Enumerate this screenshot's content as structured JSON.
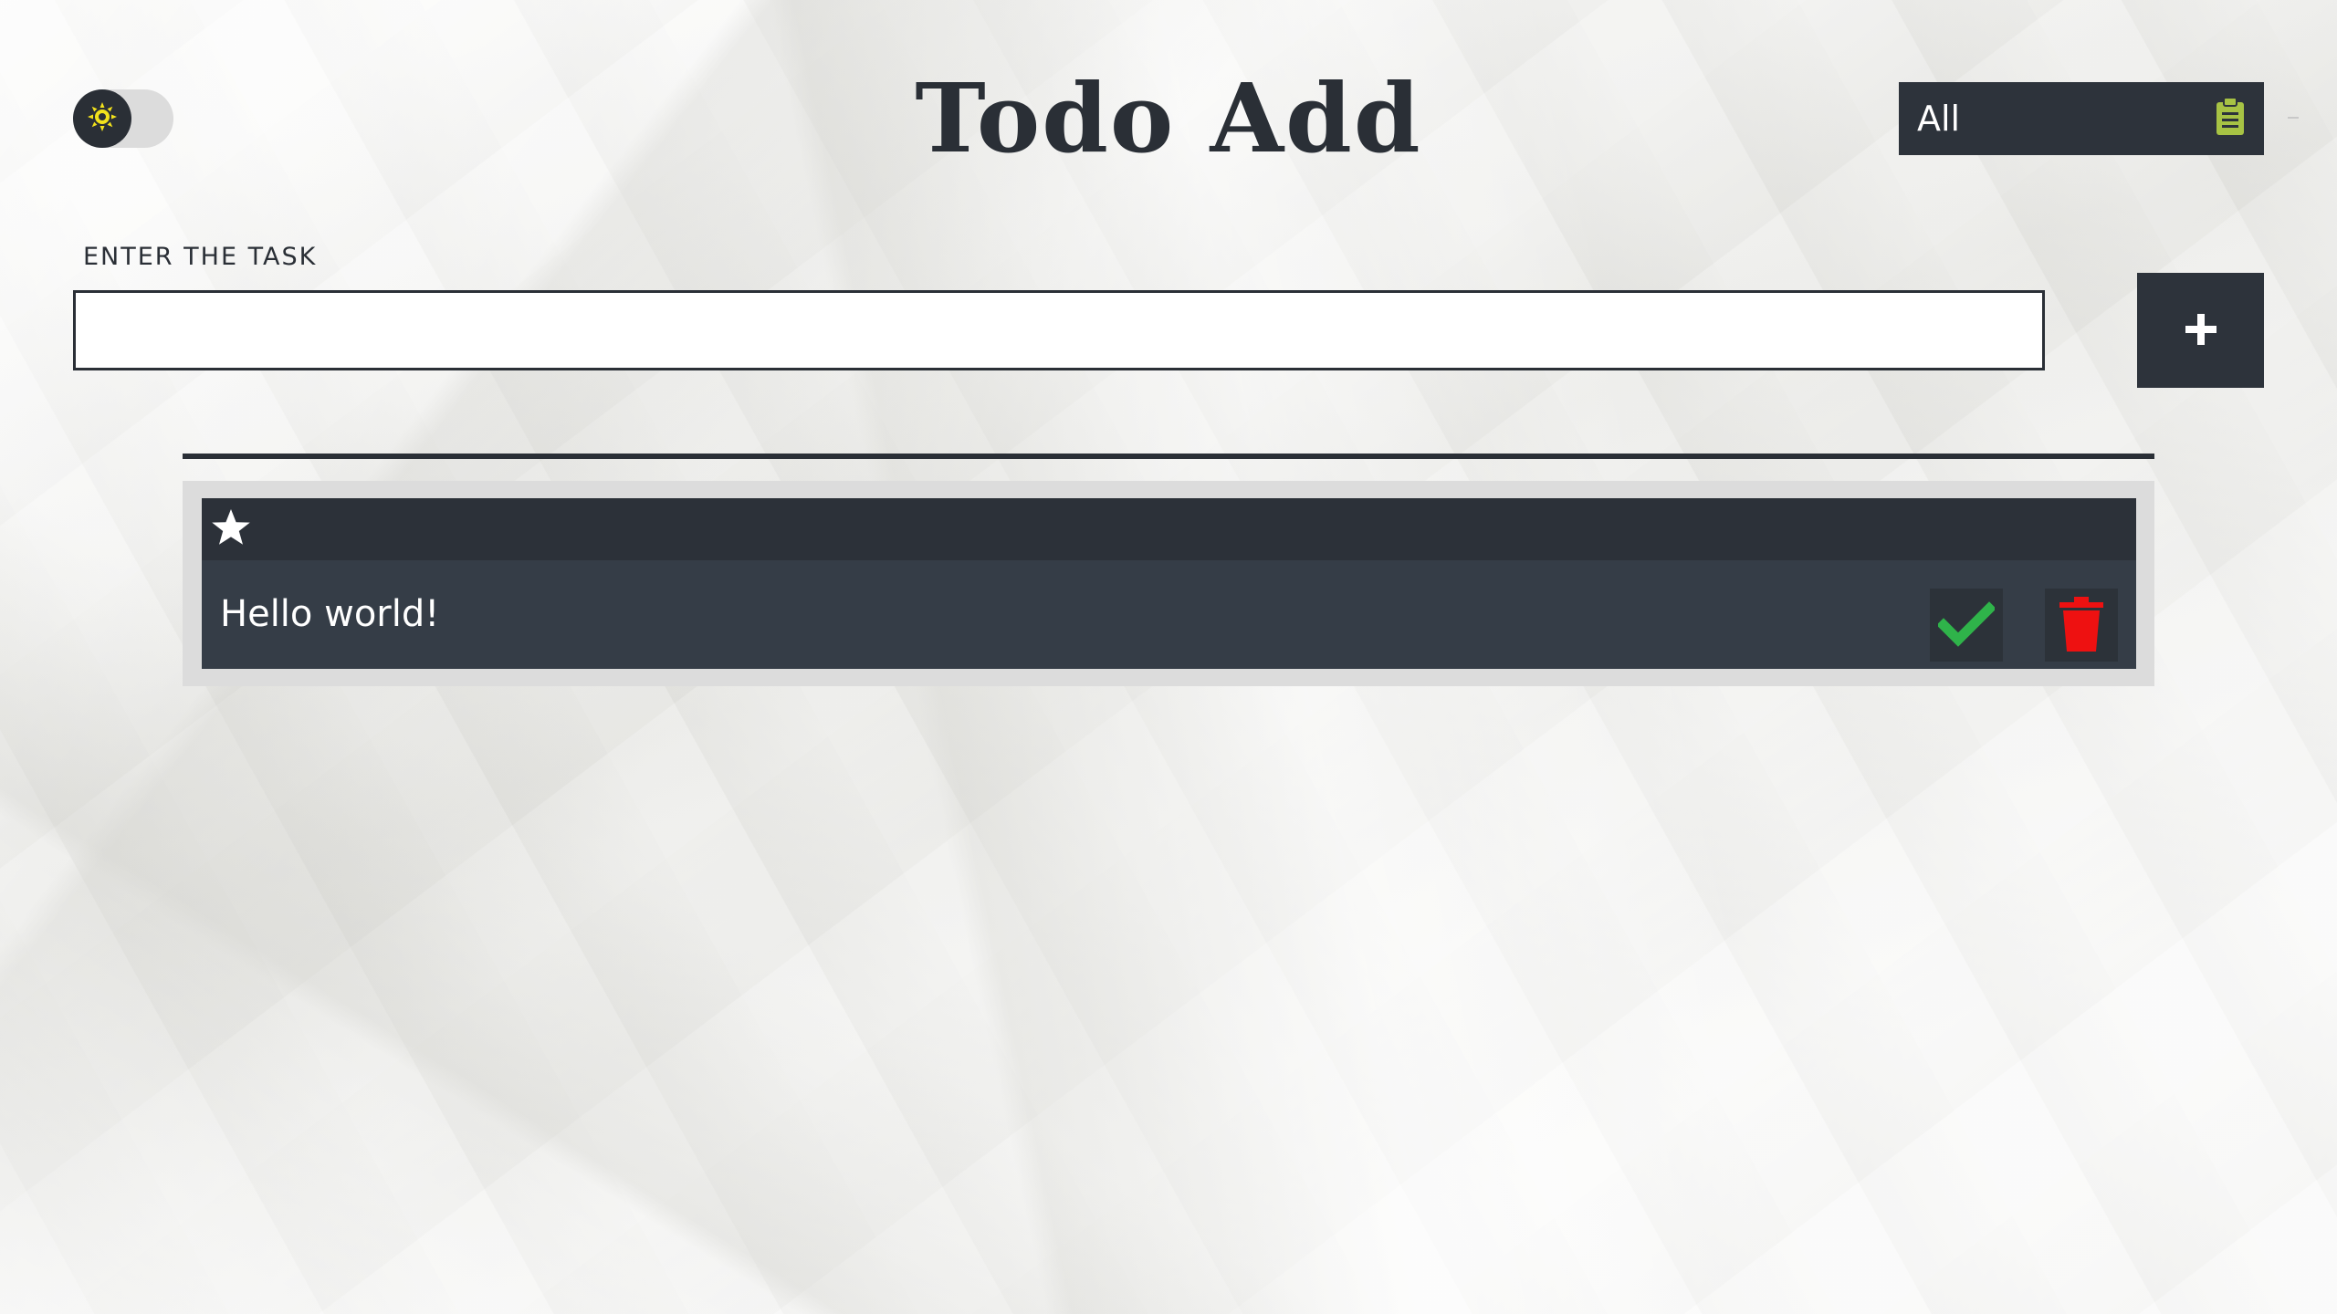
{
  "header": {
    "title": "Todo Add",
    "theme_toggle": {
      "state": "light",
      "icon": "sun-icon"
    },
    "filter": {
      "selected": "All",
      "icon": "clipboard-icon"
    }
  },
  "form": {
    "label": "ENTER THE TASK",
    "input_value": "",
    "input_placeholder": "",
    "add_button_icon": "plus-icon"
  },
  "todos": [
    {
      "text": "Hello world!",
      "starred": false,
      "completed": false
    }
  ],
  "colors": {
    "dark": "#2d333b",
    "item": "#353d47",
    "check": "#2fb34a",
    "trash": "#ee1111",
    "sun": "#f2e21c",
    "clipboard": "#a7c344"
  }
}
